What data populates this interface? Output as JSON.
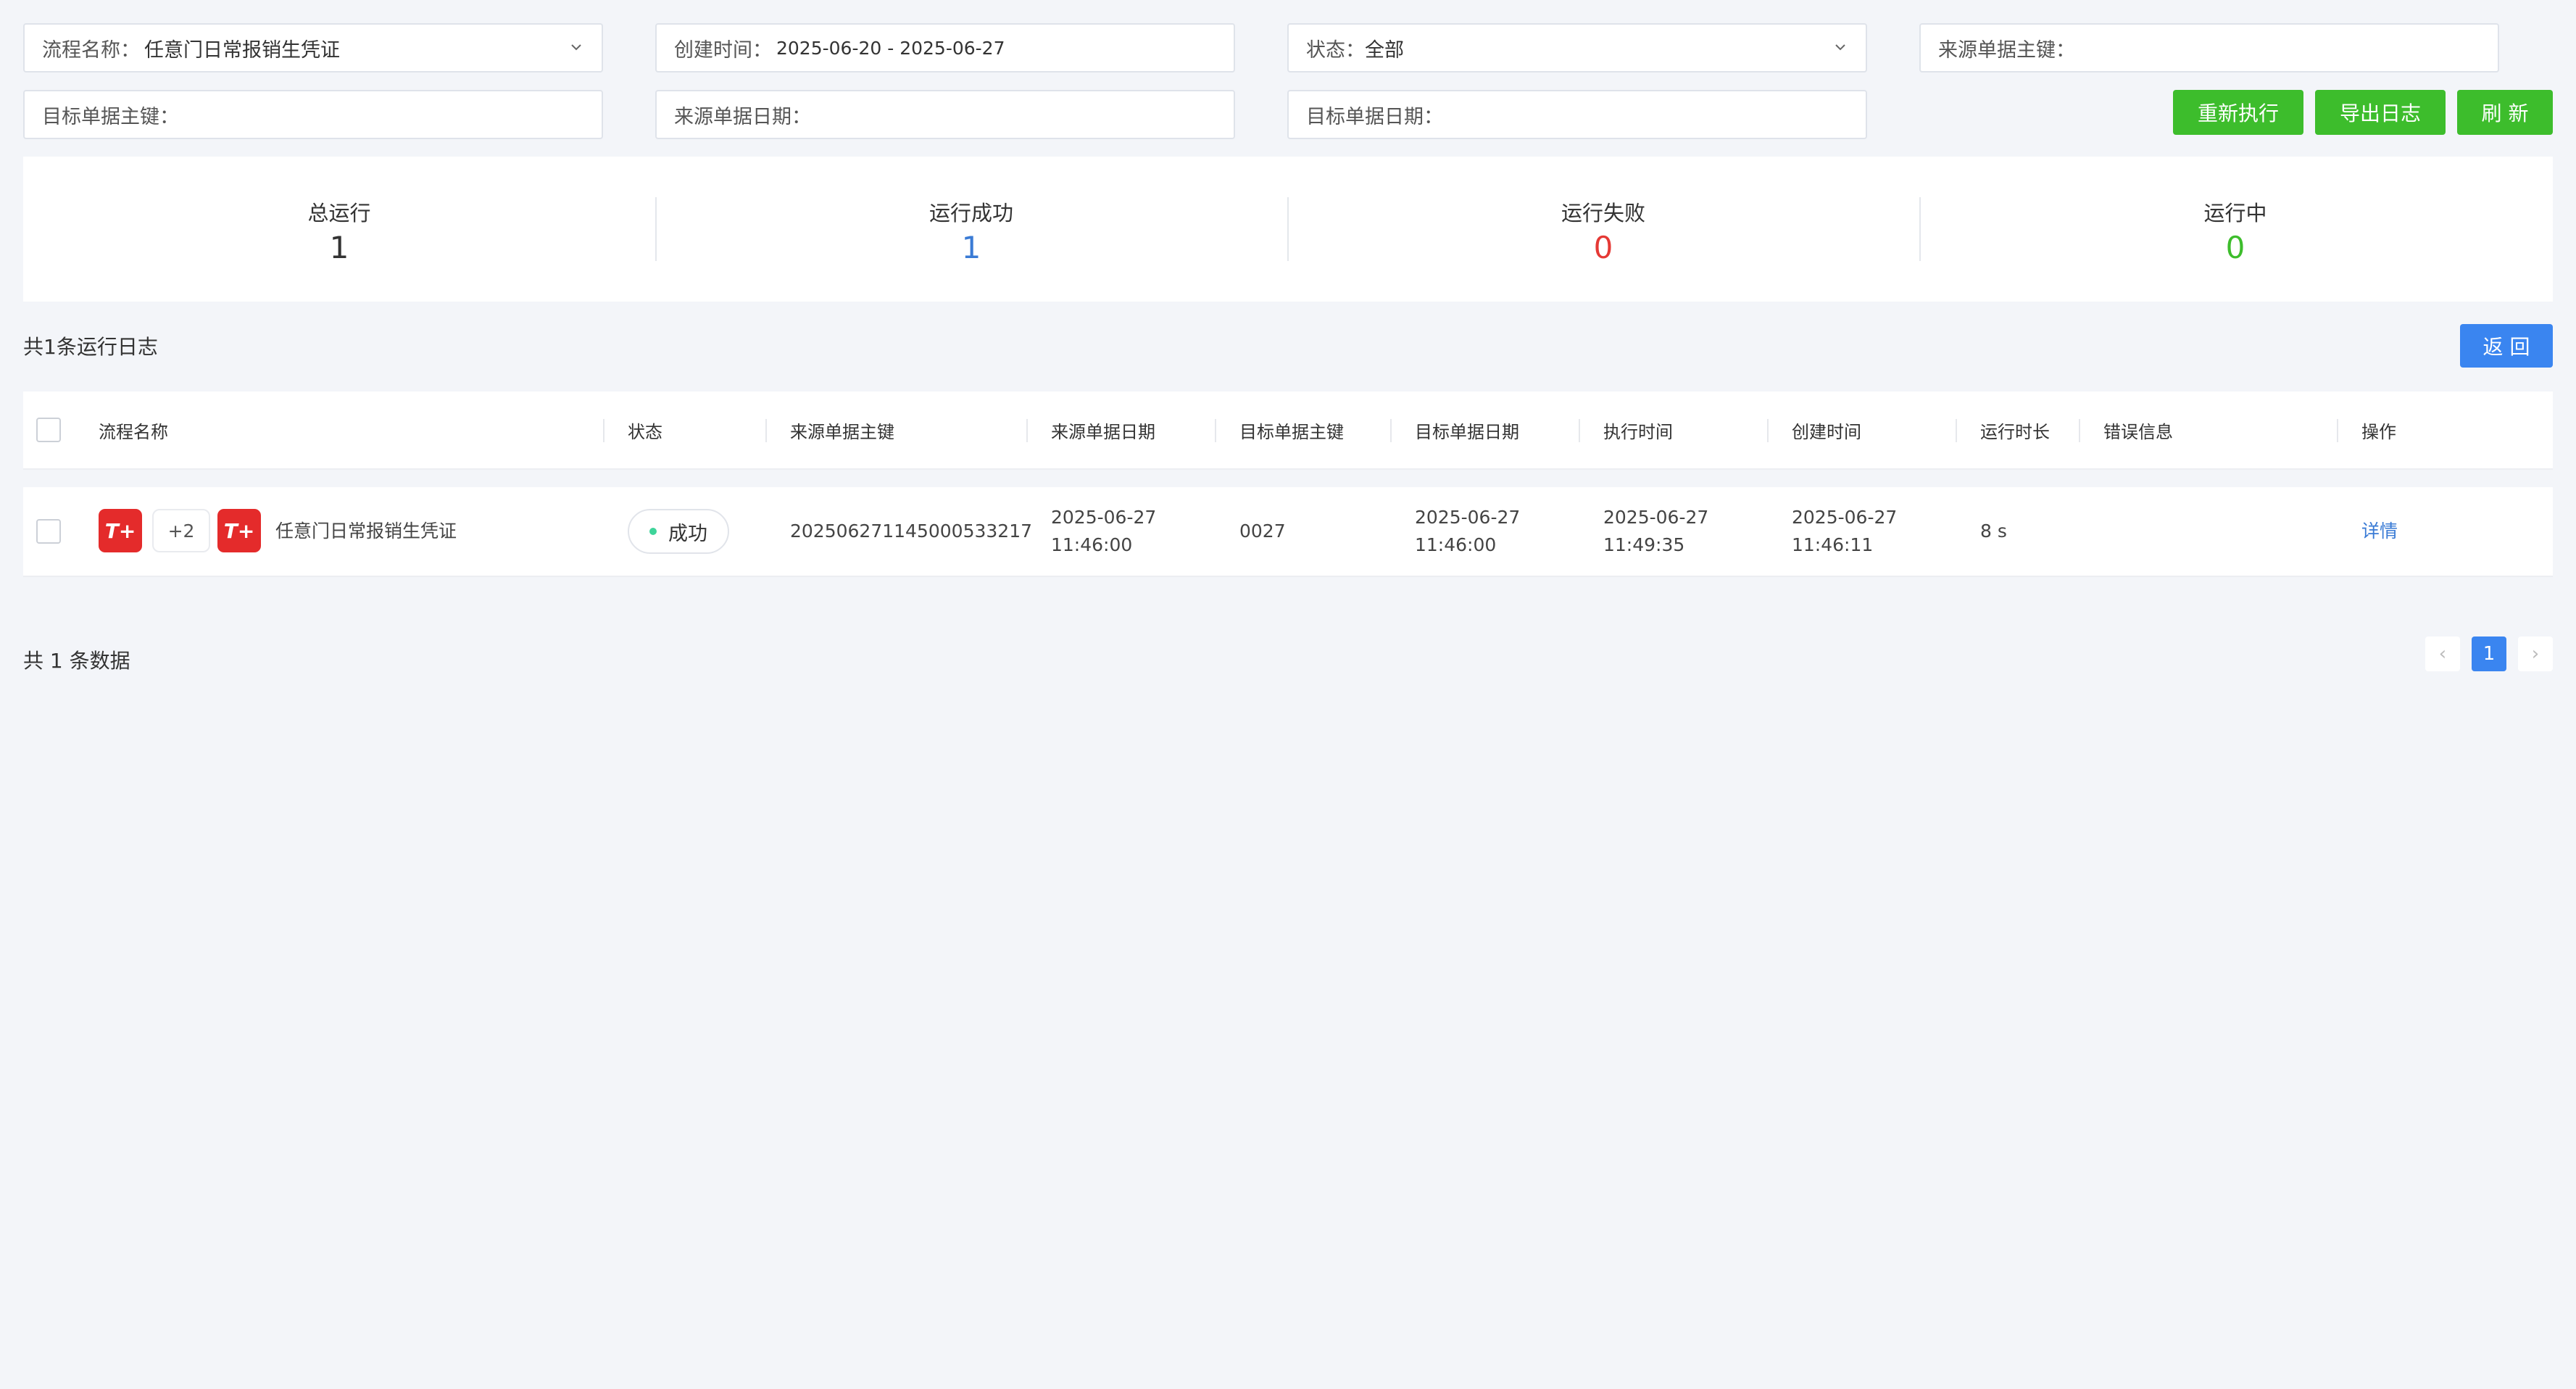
{
  "filters": {
    "process_name": {
      "label": "流程名称：",
      "value": "任意门日常报销生凭证"
    },
    "create_time": {
      "label": "创建时间：",
      "value": "2025-06-20 - 2025-06-27"
    },
    "status": {
      "label": "状态：",
      "value": "全部"
    },
    "source_key": {
      "label": "来源单据主键：",
      "value": ""
    },
    "target_key": {
      "label": "目标单据主键：",
      "value": ""
    },
    "source_date": {
      "label": "来源单据日期：",
      "value": ""
    },
    "target_date": {
      "label": "目标单据日期：",
      "value": ""
    }
  },
  "actions": {
    "rerun": "重新执行",
    "export_log": "导出日志",
    "refresh": "刷 新",
    "back": "返 回"
  },
  "stats": {
    "total": {
      "label": "总运行",
      "value": "1",
      "color": "#333333"
    },
    "success": {
      "label": "运行成功",
      "value": "1",
      "color": "#3a7bd5"
    },
    "failed": {
      "label": "运行失败",
      "value": "0",
      "color": "#e53935"
    },
    "running": {
      "label": "运行中",
      "value": "0",
      "color": "#3dbd2c"
    }
  },
  "log_count_label": "共1条运行日志",
  "table": {
    "headers": {
      "name": "流程名称",
      "status": "状态",
      "source_key": "来源单据主键",
      "source_date": "来源单据日期",
      "target_key": "目标单据主键",
      "target_date": "目标单据日期",
      "exec_time": "执行时间",
      "create_time": "创建时间",
      "duration": "运行时长",
      "error": "错误信息",
      "action": "操作"
    },
    "rows": [
      {
        "app_icon_left": "T+",
        "extra_apps": "+2",
        "app_icon_right": "T+",
        "name": "任意门日常报销生凭证",
        "status": "成功",
        "source_key": "20250627114500053321​7",
        "source_date_d": "2025-06-27",
        "source_date_t": "11:46:00",
        "target_key": "0027",
        "target_date_d": "2025-06-27",
        "target_date_t": "11:46:00",
        "exec_time_d": "2025-06-27",
        "exec_time_t": "11:49:35",
        "create_time_d": "2025-06-27",
        "create_time_t": "11:46:11",
        "duration": "8 s",
        "error": "",
        "action": "详情"
      }
    ]
  },
  "footer": {
    "total_label": "共 1 条数据",
    "current_page": "1",
    "prev": "‹",
    "next": "›"
  }
}
